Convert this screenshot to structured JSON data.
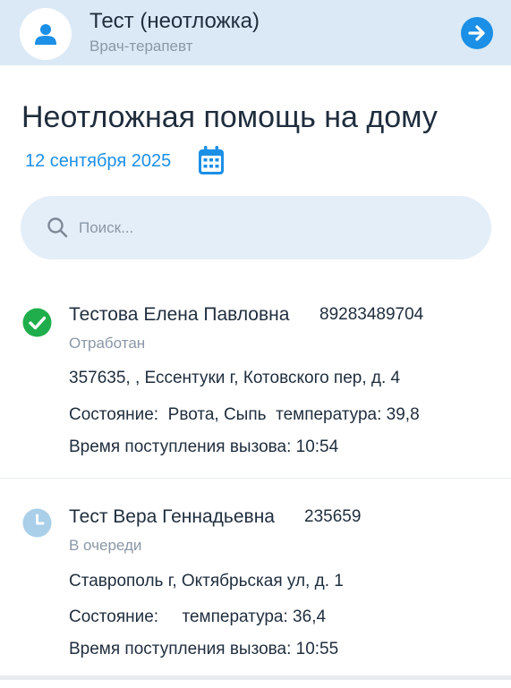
{
  "header": {
    "name": "Тест (неотложка)",
    "role": "Врач-терапевт",
    "avatar_icon": "user-icon",
    "logout_icon": "arrow-right-circle-icon"
  },
  "page": {
    "title": "Неотложная помощь на дому",
    "date": "12 сентября 2025",
    "calendar_icon": "calendar-icon"
  },
  "search": {
    "placeholder": "Поиск...",
    "value": ""
  },
  "colors": {
    "accent": "#1c8fe6",
    "header_bg": "#dbe9f6",
    "search_bg": "#e4eef8",
    "done_status": "#1fae4b",
    "queued_status": "#a9cfe9",
    "muted_text": "#8a97a6"
  },
  "calls": [
    {
      "name": "Тестова Елена Павловна",
      "phone": "89283489704",
      "status": "Отработан",
      "status_icon": "check-circle-icon",
      "address": "357635, , Ессентуки г, Котовского пер, д. 4",
      "condition": "Состояние:  Рвота, Сыпь  температура: 39,8",
      "received": "Время поступления вызова: 10:54"
    },
    {
      "name": "Тест Вера Геннадьевна",
      "phone": "235659",
      "status": "В очереди",
      "status_icon": "clock-icon",
      "address": "Ставрополь г, Октябрьская ул, д. 1",
      "condition": "Состояние:     температура: 36,4",
      "received": "Время поступления вызова: 10:55"
    }
  ]
}
